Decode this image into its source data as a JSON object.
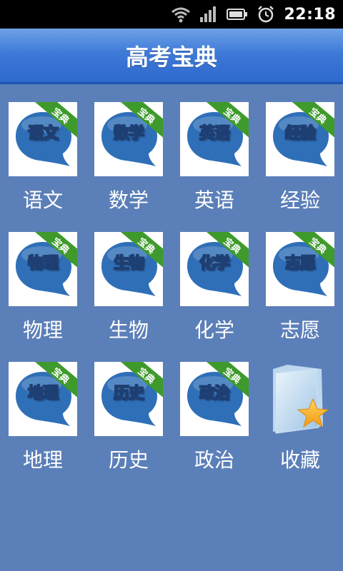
{
  "statusbar": {
    "time": "22:18",
    "icons": [
      "wifi-icon",
      "signal-icon",
      "battery-icon",
      "alarm-icon"
    ]
  },
  "header": {
    "title": "高考宝典"
  },
  "ribbon_text": "宝典",
  "colors": {
    "background": "#5b7fb8",
    "bubble": "#2f6fb8",
    "ribbon": "#3f9a2c",
    "title_bar": "#3e7ad8"
  },
  "subjects": [
    {
      "icon_text": "语文",
      "label": "语文"
    },
    {
      "icon_text": "数学",
      "label": "数学"
    },
    {
      "icon_text": "英语",
      "label": "英语"
    },
    {
      "icon_text": "经验",
      "label": "经验"
    },
    {
      "icon_text": "物理",
      "label": "物理"
    },
    {
      "icon_text": "生物",
      "label": "生物"
    },
    {
      "icon_text": "化学",
      "label": "化学"
    },
    {
      "icon_text": "志愿",
      "label": "志愿"
    },
    {
      "icon_text": "地理",
      "label": "地理"
    },
    {
      "icon_text": "历史",
      "label": "历史"
    },
    {
      "icon_text": "政治",
      "label": "政治"
    }
  ],
  "favorites": {
    "label": "收藏",
    "icon": "folder-star-icon"
  }
}
